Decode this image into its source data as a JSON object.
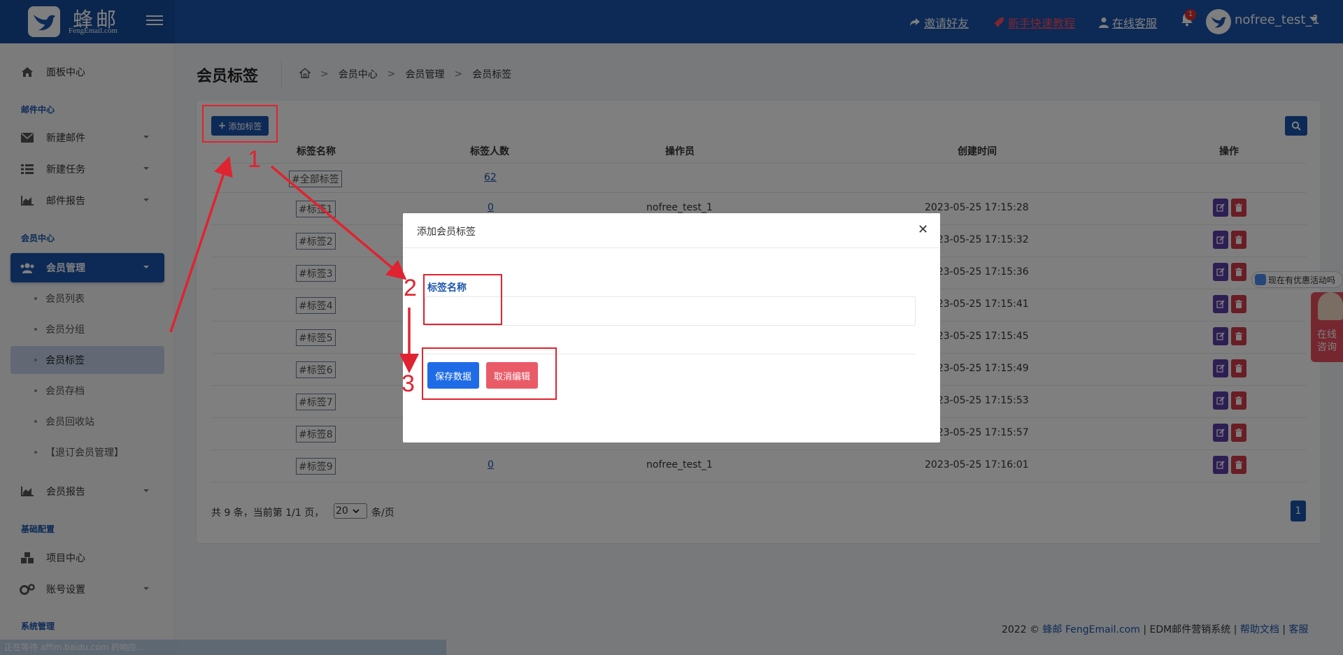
{
  "header": {
    "logo_title": "蜂邮",
    "logo_subtitle": "FengEmail.com",
    "links": [
      {
        "label": "邀请好友",
        "icon": "share-icon"
      },
      {
        "label": "新手快速教程",
        "icon": "rocket-icon"
      },
      {
        "label": "在线客服",
        "icon": "user-icon"
      }
    ],
    "notification_count": "1",
    "username": "nofree_test_1"
  },
  "sidebar": {
    "dashboard": "面板中心",
    "section_mail": "邮件中心",
    "new_mail": "新建邮件",
    "new_task": "新建任务",
    "mail_report": "邮件报告",
    "section_member": "会员中心",
    "member_manage": "会员管理",
    "sub": [
      "会员列表",
      "会员分组",
      "会员标签",
      "会员存档",
      "会员回收站",
      "【退订会员管理】"
    ],
    "member_report": "会员报告",
    "section_base": "基础配置",
    "project_center": "项目中心",
    "account_settings": "账号设置",
    "section_system": "系统管理"
  },
  "page": {
    "title": "会员标签",
    "breadcrumb": [
      "会员中心",
      "会员管理",
      "会员标签"
    ]
  },
  "toolbar": {
    "add_label": "添加标签"
  },
  "table": {
    "columns": [
      "标签名称",
      "标签人数",
      "操作员",
      "创建时间",
      "操作"
    ],
    "all_row": {
      "tag": "#全部标签",
      "count": "62"
    },
    "rows": [
      {
        "tag": "#标签1",
        "count": "0",
        "operator": "nofree_test_1",
        "time": "2023-05-25 17:15:28"
      },
      {
        "tag": "#标签2",
        "count": "",
        "operator": "",
        "time": "2023-05-25 17:15:32"
      },
      {
        "tag": "#标签3",
        "count": "",
        "operator": "",
        "time": "2023-05-25 17:15:36"
      },
      {
        "tag": "#标签4",
        "count": "",
        "operator": "",
        "time": "2023-05-25 17:15:41"
      },
      {
        "tag": "#标签5",
        "count": "",
        "operator": "",
        "time": "2023-05-25 17:15:45"
      },
      {
        "tag": "#标签6",
        "count": "",
        "operator": "",
        "time": "2023-05-25 17:15:49"
      },
      {
        "tag": "#标签7",
        "count": "",
        "operator": "",
        "time": "2023-05-25 17:15:53"
      },
      {
        "tag": "#标签8",
        "count": "",
        "operator": "",
        "time": "2023-05-25 17:15:57"
      },
      {
        "tag": "#标签9",
        "count": "0",
        "operator": "nofree_test_1",
        "time": "2023-05-25 17:16:01"
      }
    ]
  },
  "pager": {
    "summary": "共 9 条，当前第 1/1 页，",
    "page_size": "20",
    "unit": "条/页",
    "current_page": "1"
  },
  "footer": {
    "year": "2022 ©",
    "brand": "蜂邮 FengEmail.com",
    "sep1": "|",
    "system": "EDM邮件营销系统",
    "sep2": "|",
    "docs": "帮助文档",
    "sep3": "|",
    "support": "客服"
  },
  "status_bar": "正在等待 affim.baidu.com 的响应...",
  "modal": {
    "title": "添加会员标签",
    "field_label": "标签名称",
    "field_value": "",
    "save": "保存数据",
    "cancel": "取消编辑"
  },
  "annotations": {
    "step1": "1",
    "step2": "2",
    "step3": "3",
    "color": "#e02330"
  },
  "widgets": {
    "promo": "现在有优惠活动吗",
    "consult": "在线咨询"
  }
}
